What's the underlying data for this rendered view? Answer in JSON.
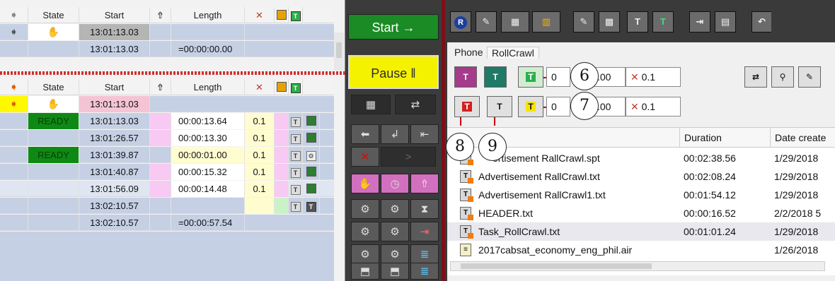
{
  "top_grid": {
    "headers": [
      "State",
      "Start",
      "Length"
    ],
    "rows": [
      {
        "start": "13:01:13.03",
        "length": ""
      },
      {
        "start": "13:01:13.03",
        "length": "=00:00:00.00"
      }
    ]
  },
  "bottom_grid": {
    "headers": [
      "State",
      "Start",
      "Length"
    ],
    "rows": [
      {
        "state": "",
        "start": "13:01:13.03",
        "length": "",
        "x": ""
      },
      {
        "state": "READY",
        "start": "13:01:13.03",
        "length": "00:00:13.64",
        "x": "0.1"
      },
      {
        "state": "",
        "start": "13:01:26.57",
        "length": "00:00:13.30",
        "x": "0.1"
      },
      {
        "state": "READY",
        "start": "13:01:39.87",
        "length": "00:00:01.00",
        "x": "0.1"
      },
      {
        "state": "",
        "start": "13:01:40.87",
        "length": "00:00:15.32",
        "x": "0.1"
      },
      {
        "state": "",
        "start": "13:01:56.09",
        "length": "00:00:14.48",
        "x": "0.1"
      },
      {
        "state": "",
        "start": "13:02:10.57",
        "length": "",
        "x": ""
      },
      {
        "state": "",
        "start": "13:02:10.57",
        "length": "=00:00:57.54",
        "x": ""
      }
    ]
  },
  "controls": {
    "start_label": "Start →",
    "pause_label": "Pause ‖"
  },
  "tabs": {
    "phone": "Phone",
    "rollcrawl": "RollCrawl"
  },
  "rollcrawl": {
    "row1_value": "0",
    "row1_value2": ".00",
    "row1_speed": "0.1",
    "row2_value": "0",
    "row2_value2": ".00",
    "row2_speed": "0.1"
  },
  "callouts": [
    "6",
    "7",
    "8",
    "9"
  ],
  "file_list": {
    "headers": {
      "name": "e",
      "duration": "Duration",
      "date": "Date create"
    },
    "rows": [
      {
        "name": "ertisement RallCrawl.spt",
        "duration": "00:02:38.56",
        "date": "1/29/2018"
      },
      {
        "name": "Advertisement RallCrawl.txt",
        "duration": "00:02:08.24",
        "date": "1/29/2018"
      },
      {
        "name": "Advertisement RallCrawl1.txt",
        "duration": "00:01:54.12",
        "date": "1/29/2018"
      },
      {
        "name": "HEADER.txt",
        "duration": "00:00:16.52",
        "date": "2/2/2018 5"
      },
      {
        "name": "Task_RollCrawl.txt",
        "duration": "00:01:01.24",
        "date": "1/29/2018"
      },
      {
        "name": "2017cabsat_economy_eng_phil.air",
        "duration": "",
        "date": "1/26/2018"
      }
    ]
  }
}
